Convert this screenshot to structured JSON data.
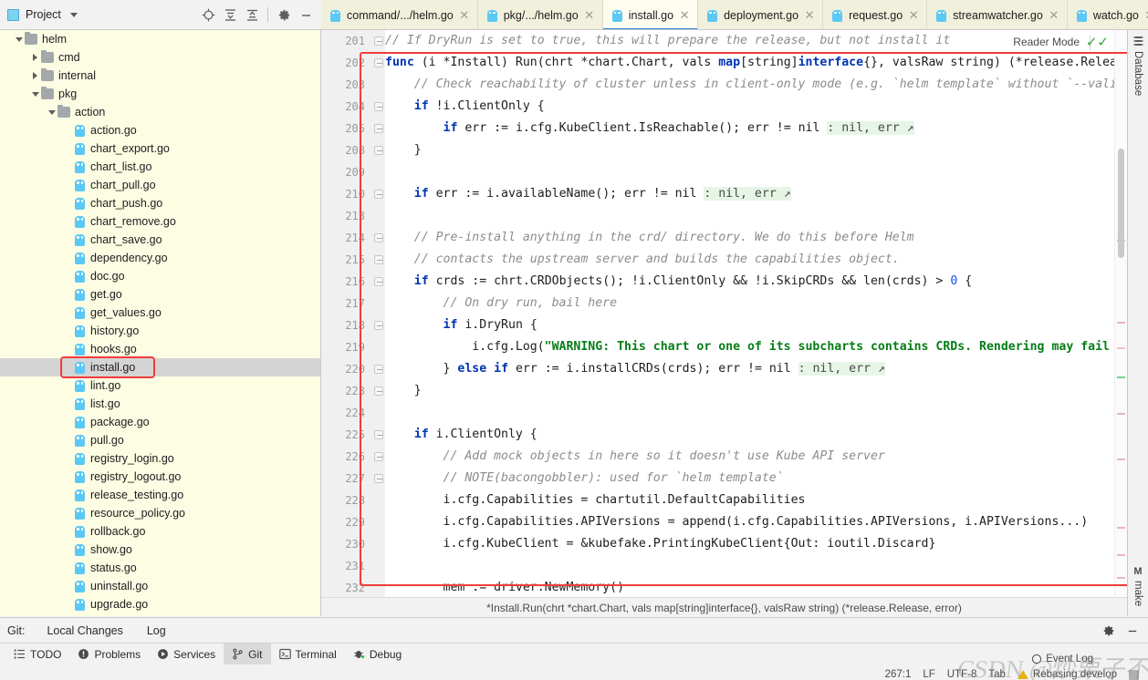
{
  "project_panel": {
    "title": "Project",
    "icons": [
      "locate-icon",
      "expand-all-icon",
      "collapse-all-icon",
      "gear-icon",
      "minimize-icon"
    ],
    "tree": [
      {
        "label": "helm",
        "depth": 2,
        "type": "folder",
        "state": "expanded"
      },
      {
        "label": "cmd",
        "depth": 3,
        "type": "folder",
        "state": "collapsed"
      },
      {
        "label": "internal",
        "depth": 3,
        "type": "folder",
        "state": "collapsed"
      },
      {
        "label": "pkg",
        "depth": 3,
        "type": "folder",
        "state": "expanded"
      },
      {
        "label": "action",
        "depth": 4,
        "type": "folder",
        "state": "expanded"
      },
      {
        "label": "action.go",
        "depth": 5,
        "type": "file"
      },
      {
        "label": "chart_export.go",
        "depth": 5,
        "type": "file"
      },
      {
        "label": "chart_list.go",
        "depth": 5,
        "type": "file"
      },
      {
        "label": "chart_pull.go",
        "depth": 5,
        "type": "file"
      },
      {
        "label": "chart_push.go",
        "depth": 5,
        "type": "file"
      },
      {
        "label": "chart_remove.go",
        "depth": 5,
        "type": "file"
      },
      {
        "label": "chart_save.go",
        "depth": 5,
        "type": "file"
      },
      {
        "label": "dependency.go",
        "depth": 5,
        "type": "file"
      },
      {
        "label": "doc.go",
        "depth": 5,
        "type": "file"
      },
      {
        "label": "get.go",
        "depth": 5,
        "type": "file"
      },
      {
        "label": "get_values.go",
        "depth": 5,
        "type": "file"
      },
      {
        "label": "history.go",
        "depth": 5,
        "type": "file"
      },
      {
        "label": "hooks.go",
        "depth": 5,
        "type": "file"
      },
      {
        "label": "install.go",
        "depth": 5,
        "type": "file",
        "selected": true,
        "highlighted": true
      },
      {
        "label": "lint.go",
        "depth": 5,
        "type": "file"
      },
      {
        "label": "list.go",
        "depth": 5,
        "type": "file"
      },
      {
        "label": "package.go",
        "depth": 5,
        "type": "file"
      },
      {
        "label": "pull.go",
        "depth": 5,
        "type": "file"
      },
      {
        "label": "registry_login.go",
        "depth": 5,
        "type": "file"
      },
      {
        "label": "registry_logout.go",
        "depth": 5,
        "type": "file"
      },
      {
        "label": "release_testing.go",
        "depth": 5,
        "type": "file"
      },
      {
        "label": "resource_policy.go",
        "depth": 5,
        "type": "file"
      },
      {
        "label": "rollback.go",
        "depth": 5,
        "type": "file"
      },
      {
        "label": "show.go",
        "depth": 5,
        "type": "file"
      },
      {
        "label": "status.go",
        "depth": 5,
        "type": "file"
      },
      {
        "label": "uninstall.go",
        "depth": 5,
        "type": "file"
      },
      {
        "label": "upgrade.go",
        "depth": 5,
        "type": "file"
      }
    ]
  },
  "editor_tabs": {
    "tabs": [
      {
        "label": "command/.../helm.go",
        "active": false
      },
      {
        "label": "pkg/.../helm.go",
        "active": false
      },
      {
        "label": "install.go",
        "active": true
      },
      {
        "label": "deployment.go",
        "active": false
      },
      {
        "label": "request.go",
        "active": false
      },
      {
        "label": "streamwatcher.go",
        "active": false
      },
      {
        "label": "watch.go",
        "active": false
      }
    ],
    "overflow_label": "chevron-down-icon",
    "close_glyph": "✕"
  },
  "editor": {
    "reader_mode_label": "Reader Mode",
    "inspection_status": "ok",
    "line_numbers": [
      201,
      202,
      203,
      204,
      205,
      208,
      209,
      210,
      213,
      214,
      215,
      216,
      217,
      218,
      219,
      220,
      223,
      224,
      225,
      226,
      227,
      228,
      229,
      230,
      231,
      232
    ],
    "lines": [
      "// If DryRun is set to true, this will prepare the release, but not install it",
      "func (i *Install) Run(chrt *chart.Chart, vals map[string]interface{}, valsRaw string) (*release.Release, error) {",
      "    // Check reachability of cluster unless in client-only mode (e.g. `helm template` without `--validate`)",
      "    if !i.ClientOnly {",
      "        if err := i.cfg.KubeClient.IsReachable(); err != nil : nil, err ↗",
      "    }",
      "",
      "    if err := i.availableName(); err != nil : nil, err ↗",
      "",
      "    // Pre-install anything in the crd/ directory. We do this before Helm",
      "    // contacts the upstream server and builds the capabilities object.",
      "    if crds := chrt.CRDObjects(); !i.ClientOnly && !i.SkipCRDs && len(crds) > 0 {",
      "        // On dry run, bail here",
      "        if i.DryRun {",
      "            i.cfg.Log(\"WARNING: This chart or one of its subcharts contains CRDs. Rendering may fail or c",
      "        } else if err := i.installCRDs(crds); err != nil : nil, err ↗",
      "    }",
      "",
      "    if i.ClientOnly {",
      "        // Add mock objects in here so it doesn't use Kube API server",
      "        // NOTE(bacongobbler): used for `helm template`",
      "        i.cfg.Capabilities = chartutil.DefaultCapabilities",
      "        i.cfg.Capabilities.APIVersions = append(i.cfg.Capabilities.APIVersions, i.APIVersions...)",
      "        i.cfg.KubeClient = &kubefake.PrintingKubeClient{Out: ioutil.Discard}",
      "",
      "        mem := driver.NewMemory()"
    ],
    "breadcrumb": "*Install.Run(chrt *chart.Chart, vals map[string]interface{}, valsRaw string) (*release.Release, error)"
  },
  "right_strip": {
    "top_tab": "Database",
    "bottom_tab": "make"
  },
  "git_panel": {
    "label": "Git:",
    "tabs": [
      {
        "label": "Local Changes",
        "active": true
      },
      {
        "label": "Log",
        "active": false
      }
    ],
    "actions": [
      "gear-icon",
      "minimize-icon"
    ]
  },
  "tool_window_bar": {
    "items": [
      {
        "label": "TODO",
        "icon": "list-icon",
        "active": false
      },
      {
        "label": "Problems",
        "icon": "warning-icon",
        "active": false
      },
      {
        "label": "Services",
        "icon": "play-icon",
        "active": false
      },
      {
        "label": "Git",
        "icon": "branch-icon",
        "active": true
      },
      {
        "label": "Terminal",
        "icon": "terminal-icon",
        "active": false
      },
      {
        "label": "Debug",
        "icon": "bug-icon",
        "active": false
      }
    ]
  },
  "status_bar": {
    "event_log": "Event Log",
    "caret_position": "267:1",
    "line_separator": "LF",
    "encoding": "UTF-8",
    "indent": "Tab",
    "vcs_branch": "Rebasing develop"
  },
  "watermark": {
    "line1": "CSDN @炒栗子不加糖"
  },
  "colors": {
    "accent_blue": "#2f80d6",
    "highlight_red": "#f23c3c",
    "tab_bg": "#f0f0dc",
    "tree_bg": "#fdfde4",
    "keyword": "#0033b3",
    "string": "#067d17",
    "comment": "#8c8c8c"
  }
}
